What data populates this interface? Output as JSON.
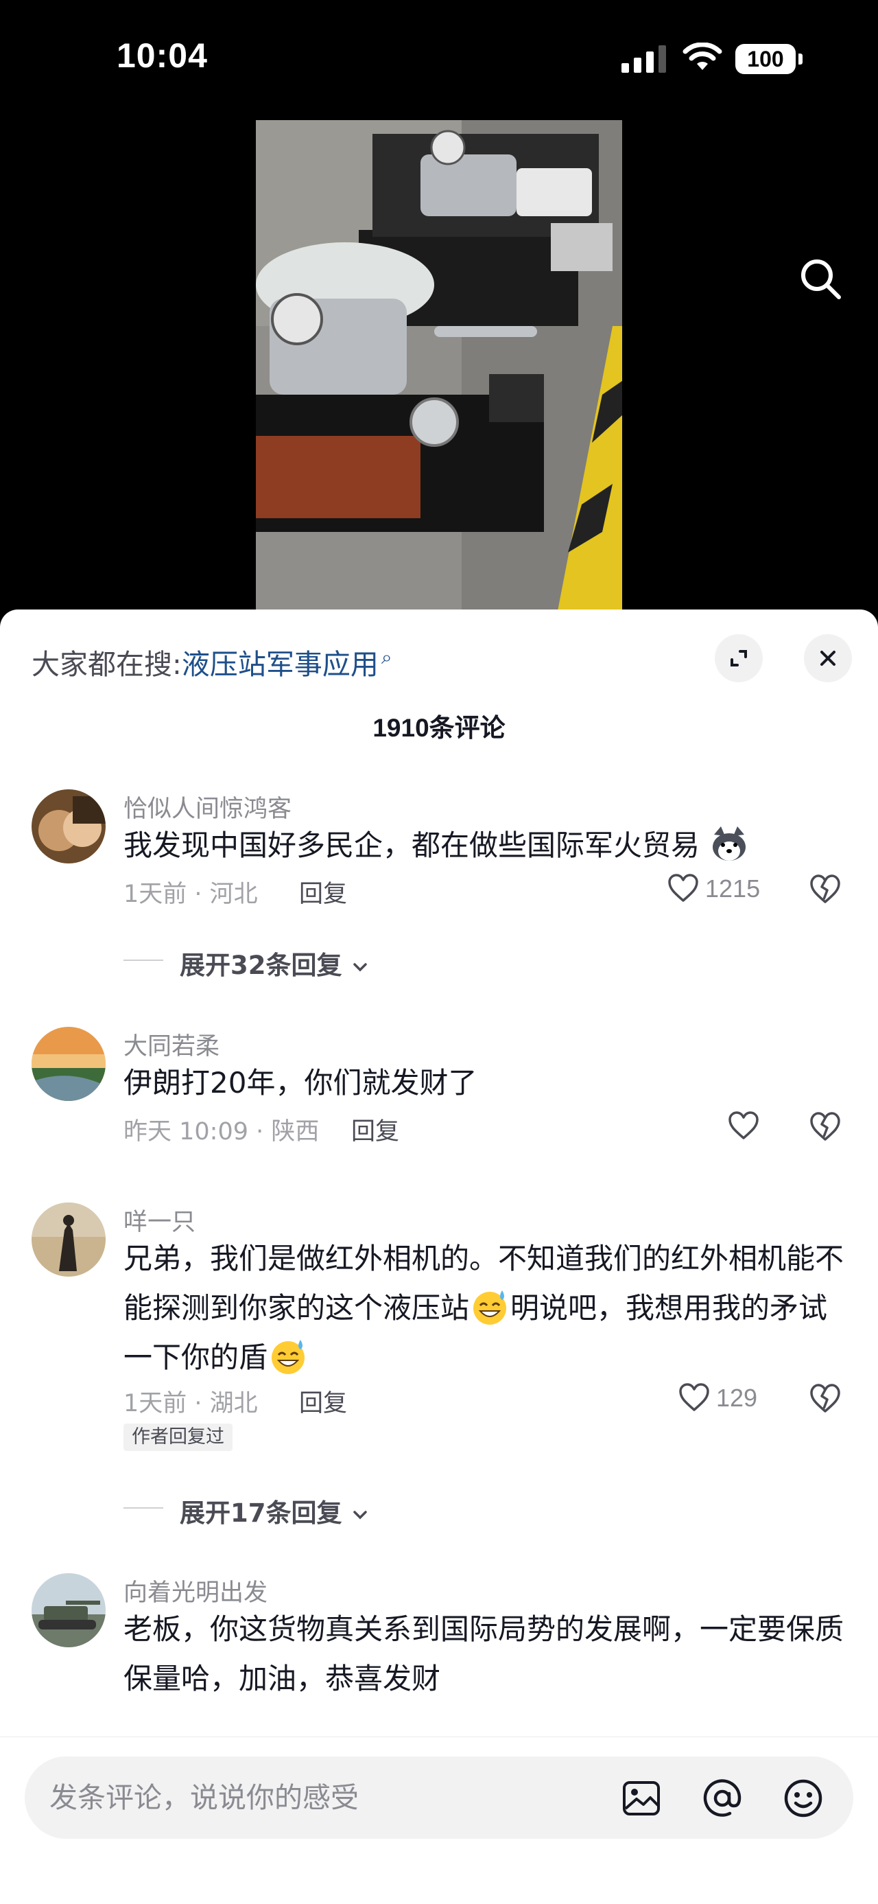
{
  "status_bar": {
    "time": "10:04",
    "battery": "100"
  },
  "sheet": {
    "hot_search_label": "大家都在搜:",
    "hot_search_keyword": "液压站军事应用",
    "comment_count": "1910条评论"
  },
  "comments": [
    {
      "user": "恰似人间惊鸿客",
      "text": "我发现中国好多民企，都在做些国际军火贸易",
      "meta": "1天前 · 河北",
      "reply_label": "回复",
      "likes": "1215",
      "expand": "展开32条回复"
    },
    {
      "user": "大同若柔",
      "text": "伊朗打20年，你们就发财了",
      "meta": "昨天 10:09 · 陕西",
      "reply_label": "回复",
      "likes": ""
    },
    {
      "user": "咩一只",
      "text_a": "兄弟，我们是做红外相机的。不知道我们的红外相机能不能探测到你家的这个液压站",
      "text_b": "明说吧，我想用我的矛试一下你的盾",
      "meta": "1天前 · 湖北",
      "reply_label": "回复",
      "likes": "129",
      "author_tag": "作者回复过",
      "expand": "展开17条回复"
    },
    {
      "user": "向着光明出发",
      "text": "老板，你这货物真关系到国际局势的发展啊，一定要保质保量哈，加油，恭喜发财"
    }
  ],
  "input": {
    "placeholder": "发条评论，说说你的感受"
  },
  "icons": {
    "search": "search-icon",
    "expand": "expand-icon",
    "close": "close-icon",
    "like": "heart-icon",
    "dislike": "broken-heart-icon",
    "chevron": "chevron-down-icon",
    "image": "image-icon",
    "mention": "at-icon",
    "emoji": "smiley-icon"
  },
  "colors": {
    "keyword": "#1e4f8a",
    "text": "#161823",
    "muted": "#8a8b91",
    "sheet_bg": "#ffffff"
  }
}
